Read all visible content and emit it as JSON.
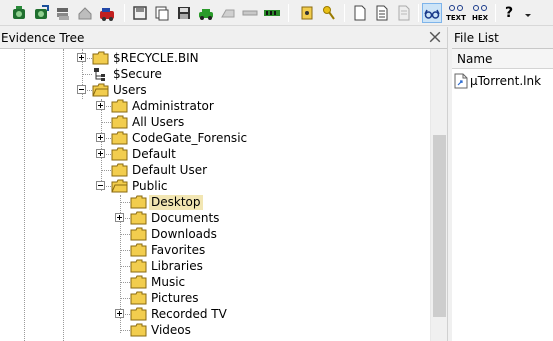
{
  "toolbar": {
    "buttons": [
      {
        "icon": "add-evidence-icon"
      },
      {
        "icon": "add-all-evidence-icon"
      },
      {
        "icon": "image-drive-icon"
      },
      {
        "icon": "print-icon"
      },
      {
        "icon": "export-icon"
      },
      {
        "icon": "save-icon"
      },
      {
        "icon": "copy-icon"
      },
      {
        "icon": "floppy-icon"
      },
      {
        "icon": "green-car-icon"
      },
      {
        "icon": "gray-car-icon"
      },
      {
        "icon": "bar-icon"
      },
      {
        "icon": "memory-icon"
      },
      {
        "icon": "folder-tag-icon"
      },
      {
        "icon": "key-icon"
      },
      {
        "icon": "blank-page-icon"
      },
      {
        "icon": "text-page-icon"
      },
      {
        "icon": "gray-page-icon"
      },
      {
        "icon": "glasses-icon"
      },
      {
        "icon": "text-view-icon",
        "label": "TEXT"
      },
      {
        "icon": "hex-view-icon",
        "label": "HEX"
      },
      {
        "icon": "help-icon",
        "label": "?"
      }
    ]
  },
  "evidence_tree": {
    "title": "Evidence Tree",
    "items": [
      {
        "label": "$RECYCLE.BIN"
      },
      {
        "label": "$Secure"
      },
      {
        "label": "Users"
      },
      {
        "label": "Administrator"
      },
      {
        "label": "All Users"
      },
      {
        "label": "CodeGate_Forensic"
      },
      {
        "label": "Default"
      },
      {
        "label": "Default User"
      },
      {
        "label": "Public"
      },
      {
        "label": "Desktop"
      },
      {
        "label": "Documents"
      },
      {
        "label": "Downloads"
      },
      {
        "label": "Favorites"
      },
      {
        "label": "Libraries"
      },
      {
        "label": "Music"
      },
      {
        "label": "Pictures"
      },
      {
        "label": "Recorded TV"
      },
      {
        "label": "Videos"
      }
    ]
  },
  "file_list": {
    "title": "File List",
    "column": "Name",
    "files": [
      {
        "name": "µTorrent.lnk"
      }
    ]
  },
  "colors": {
    "folder": "#f2cd4e",
    "selection": "#f2e6b3",
    "active_button": "#cde4f7"
  }
}
